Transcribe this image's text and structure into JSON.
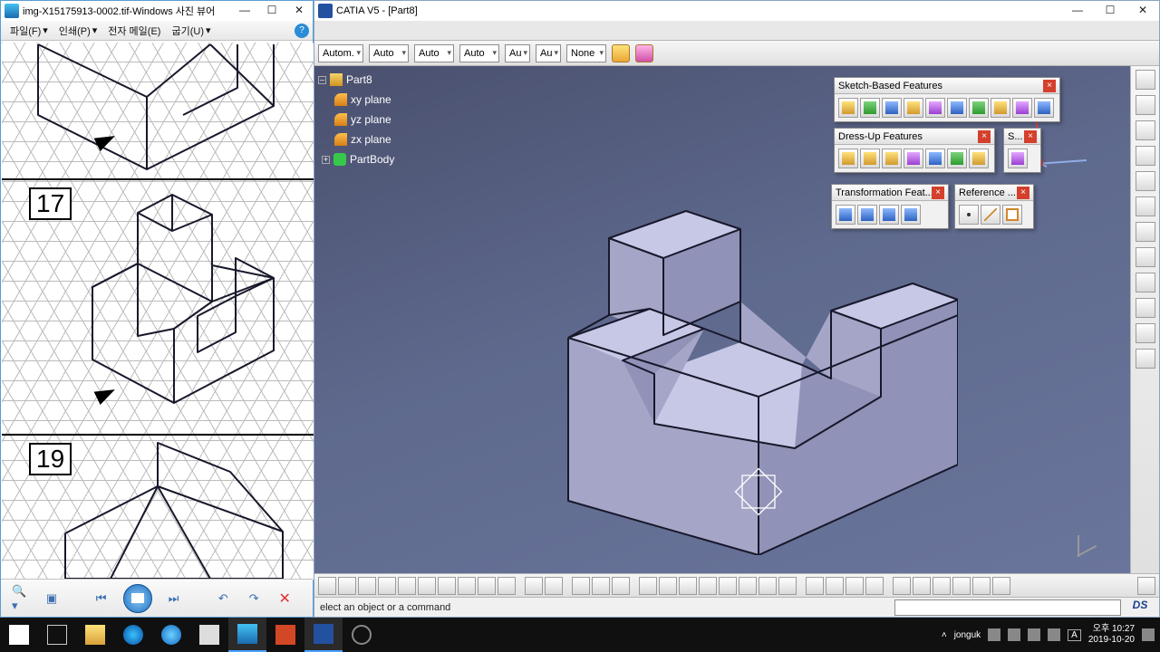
{
  "viewer": {
    "title": "img-X15175913-0002.tif-Windows 사진 뷰어",
    "menu": {
      "file": "파일(F)",
      "print": "인쇄(P)",
      "mail": "전자 메일(E)",
      "write": "굽기(U)"
    },
    "labels": {
      "num17": "17",
      "num19": "19"
    }
  },
  "catia": {
    "title": "CATIA V5 - [Part8]",
    "combos": {
      "c1": "Autom.",
      "c2": "Auto",
      "c3": "Auto",
      "c4": "Auto",
      "c5": "Au",
      "c6": "Au",
      "c7": "None"
    },
    "tree": {
      "root": "Part8",
      "xy": "xy plane",
      "yz": "yz plane",
      "zx": "zx plane",
      "body": "PartBody"
    },
    "panels": {
      "sketch": "Sketch-Based Features",
      "dressup": "Dress-Up Features",
      "surf": "S...",
      "transf": "Transformation Feat...",
      "ref": "Reference ..."
    },
    "status_prompt": "elect an object or a command"
  },
  "taskbar": {
    "user": "jonguk",
    "time": "오후 10:27",
    "date": "2019-10-20"
  }
}
